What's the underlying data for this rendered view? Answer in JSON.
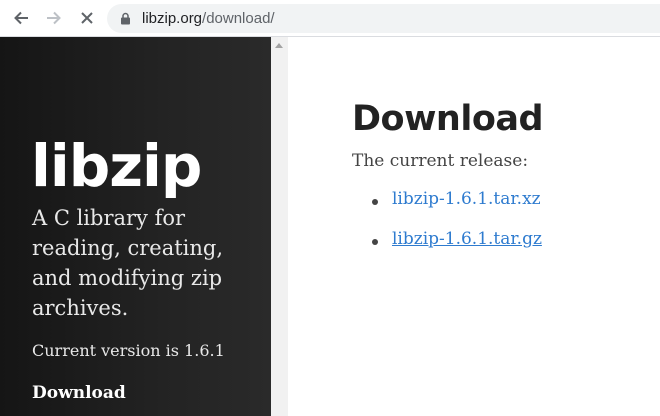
{
  "browser": {
    "url_host": "libzip.org",
    "url_path": "/download/"
  },
  "sidebar": {
    "site_title": "libzip",
    "tagline": "A C library for reading, creating, and modifying zip archives.",
    "version_text": "Current version is 1.6.1",
    "nav": {
      "download": "Download"
    }
  },
  "main": {
    "heading": "Download",
    "release_label": "The current release:",
    "downloads": [
      {
        "label": "libzip-1.6.1.tar.xz"
      },
      {
        "label": "libzip-1.6.1.tar.gz"
      }
    ]
  },
  "colors": {
    "link": "#2e7bcf",
    "sidebar_bg": "#1e1e1e"
  }
}
